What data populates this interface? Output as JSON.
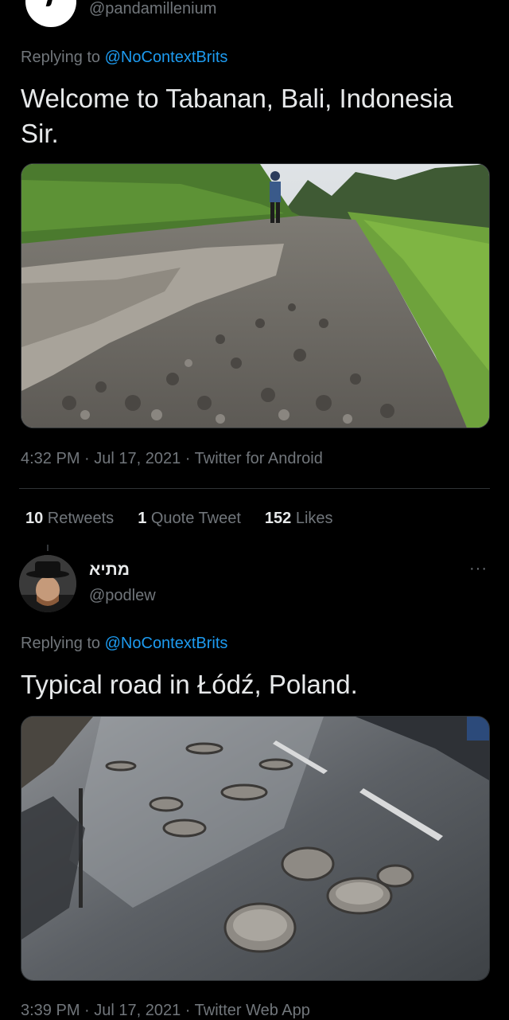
{
  "tweet1": {
    "handle": "@pandamillenium",
    "replying_prefix": "Replying to ",
    "replying_mention": "@NoContextBrits",
    "text_line1": "Welcome to Tabanan,  Bali, Indonesia",
    "text_line2": "Sir.",
    "timestamp": "4:32 PM · Jul 17, 2021 · Twitter for Android",
    "stats": {
      "retweets_count": "10",
      "retweets_label": " Retweets",
      "quotes_count": "1",
      "quotes_label": " Quote Tweet",
      "likes_count": "152",
      "likes_label": " Likes"
    }
  },
  "tweet2": {
    "name": "מתיא",
    "handle": "@podlew",
    "more": "···",
    "replying_prefix": "Replying to ",
    "replying_mention": "@NoContextBrits",
    "text": "Typical road in Łódź, Poland.",
    "timestamp": "3:39 PM · Jul 17, 2021 · Twitter Web App"
  },
  "colors": {
    "background": "#000000",
    "text": "#e7e9ea",
    "secondary": "#71767b",
    "link": "#1d9bf0",
    "divider": "#2f3336"
  }
}
